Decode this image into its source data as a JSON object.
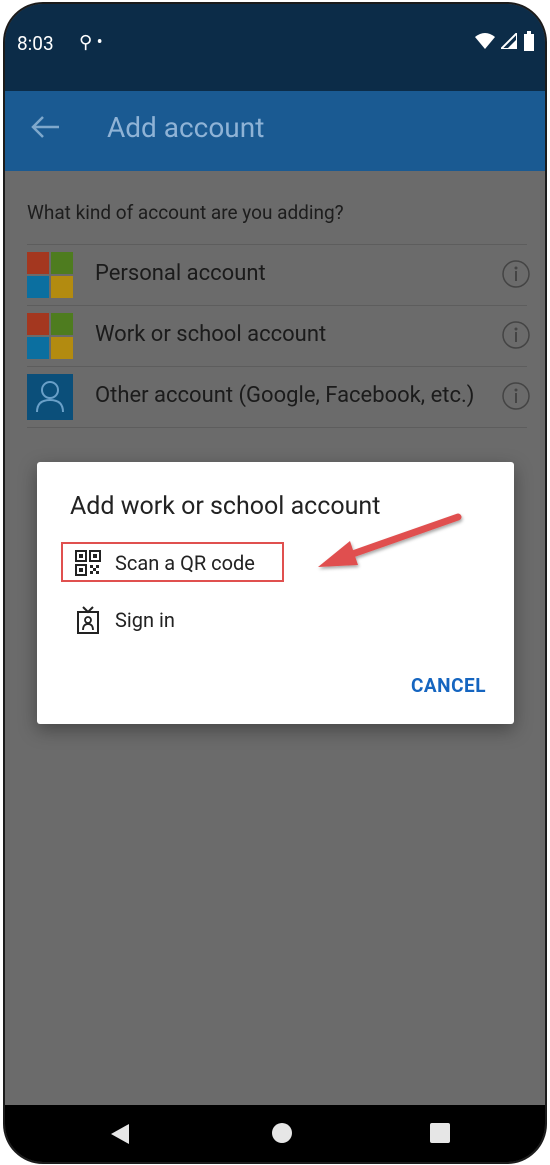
{
  "status": {
    "time": "8:03",
    "left_icons": "⚲ •"
  },
  "appbar": {
    "title": "Add account"
  },
  "question": "What kind of account are you adding?",
  "accounts": [
    {
      "label": "Personal account"
    },
    {
      "label": "Work or school account"
    },
    {
      "label": "Other account (Google, Facebook, etc.)"
    }
  ],
  "dialog": {
    "title": "Add work or school account",
    "items": [
      {
        "label": "Scan a QR code"
      },
      {
        "label": "Sign in"
      }
    ],
    "cancel_label": "CANCEL"
  },
  "colors": {
    "accent": "#1565c0",
    "appbar": "#1a5a92",
    "statusbar": "#0c2c48",
    "annotation": "#e0504f"
  }
}
